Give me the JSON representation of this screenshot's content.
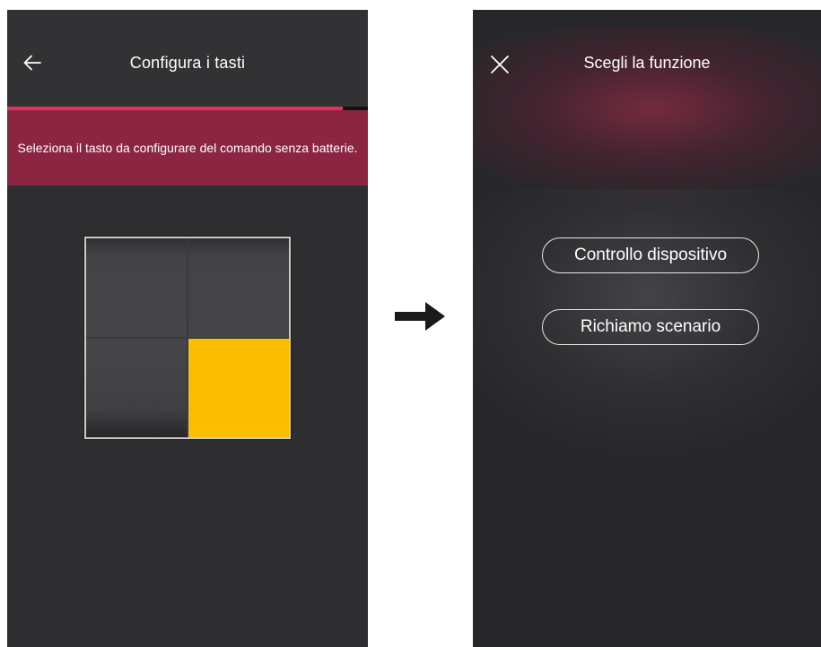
{
  "left_screen": {
    "title": "Configura i tasti",
    "back_icon": "arrow-left-icon",
    "progress_percent": 93,
    "banner_text": "Seleziona il tasto da configurare del comando senza batterie.",
    "keypad": {
      "keys": [
        "top-left",
        "top-right",
        "bottom-left",
        "bottom-right"
      ],
      "selected_key": "bottom-right"
    }
  },
  "transition_icon": "arrow-right-icon",
  "right_screen": {
    "title": "Scegli la funzione",
    "close_icon": "close-icon",
    "options": [
      {
        "label": "Controllo dispositivo"
      },
      {
        "label": "Richiamo scenario"
      }
    ]
  },
  "colors": {
    "accent": "#e2315e",
    "banner": "#8b2542",
    "selected_key": "#fbbd00",
    "screen_bg": "#2e2e30"
  }
}
